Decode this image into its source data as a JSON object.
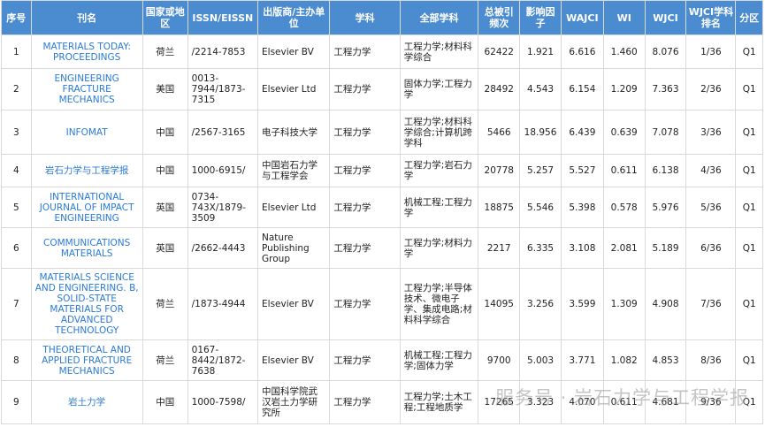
{
  "headers": [
    "序号",
    "刊名",
    "国家或地区",
    "ISSN/EISSN",
    "出版商/主办单位",
    "学科",
    "全部学科",
    "总被引频次",
    "影响因子",
    "WAJCI",
    "WI",
    "WJCI",
    "WJCI学科排名",
    "分区"
  ],
  "rows": [
    [
      "1",
      "MATERIALS TODAY: PROCEEDINGS",
      "荷兰",
      "/2214-7853",
      "Elsevier BV",
      "工程力学",
      "工程力学;材料科学综合",
      "62422",
      "1.921",
      "6.616",
      "1.460",
      "8.076",
      "1/36",
      "Q1"
    ],
    [
      "2",
      "ENGINEERING FRACTURE MECHANICS",
      "美国",
      "0013-7944/1873-7315",
      "Elsevier Ltd",
      "工程力学",
      "固体力学;工程力学",
      "28492",
      "4.543",
      "6.154",
      "1.209",
      "7.363",
      "2/36",
      "Q1"
    ],
    [
      "3",
      "INFOMAT",
      "中国",
      "/2567-3165",
      "电子科技大学",
      "工程力学",
      "工程力学;材料科学综合;计算机跨学科",
      "5466",
      "18.956",
      "6.439",
      "0.639",
      "7.078",
      "3/36",
      "Q1"
    ],
    [
      "4",
      "岩石力学与工程学报",
      "中国",
      "1000-6915/",
      "中国岩石力学与工程学会",
      "工程力学",
      "工程力学;岩石力学",
      "20778",
      "5.257",
      "5.527",
      "0.611",
      "6.138",
      "4/36",
      "Q1"
    ],
    [
      "5",
      "INTERNATIONAL JOURNAL OF IMPACT ENGINEERING",
      "英国",
      "0734-743X/1879-3509",
      "Elsevier Ltd",
      "工程力学",
      "机械工程;工程力学",
      "18875",
      "5.546",
      "5.398",
      "0.578",
      "5.976",
      "5/36",
      "Q1"
    ],
    [
      "6",
      "COMMUNICATIONS MATERIALS",
      "英国",
      "/2662-4443",
      "Nature Publishing Group",
      "工程力学",
      "工程力学;材料力学",
      "2217",
      "6.335",
      "3.108",
      "2.081",
      "5.189",
      "6/36",
      "Q1"
    ],
    [
      "7",
      "MATERIALS SCIENCE AND ENGINEERING. B, SOLID-STATE MATERIALS FOR ADVANCED TECHNOLOGY",
      "荷兰",
      "/1873-4944",
      "Elsevier BV",
      "工程力学",
      "工程力学;半导体技术、微电子学、集成电路;材料科学综合",
      "14095",
      "3.256",
      "3.599",
      "1.309",
      "4.908",
      "7/36",
      "Q1"
    ],
    [
      "8",
      "THEORETICAL AND APPLIED FRACTURE MECHANICS",
      "荷兰",
      "0167-8442/1872-7638",
      "Elsevier BV",
      "工程力学",
      "机械工程;工程力学;固体力学",
      "9700",
      "5.003",
      "3.771",
      "1.082",
      "4.853",
      "8/36",
      "Q1"
    ],
    [
      "9",
      "岩土力学",
      "中国",
      "1000-7598/",
      "中国科学院武汉岩土力学研究所",
      "工程力学",
      "工程力学;土木工程;工程地质学",
      "17265",
      "3.323",
      "4.070",
      "0.611",
      "4.681",
      "9/36",
      "Q1"
    ]
  ],
  "watermark": "服务号 · 岩石力学与工程学报"
}
